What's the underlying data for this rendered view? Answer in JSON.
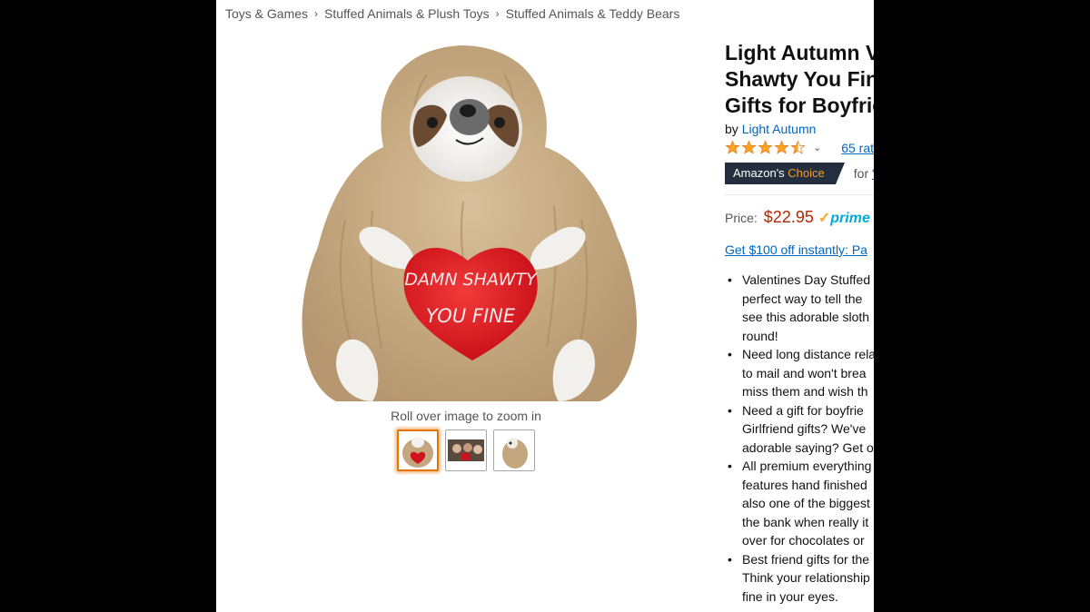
{
  "breadcrumb": {
    "items": [
      "Toys & Games",
      "Stuffed Animals & Plush Toys",
      "Stuffed Animals & Teddy Bears"
    ],
    "separator": "›"
  },
  "product": {
    "image_heart_text_line1": "DAMN SHAWTY",
    "image_heart_text_line2": "YOU FINE",
    "zoom_hint": "Roll over image to zoom in",
    "title_lines": [
      "Light Autumn V",
      "Shawty You Fine",
      "Gifts for Boyfrie"
    ],
    "by_prefix": "by",
    "brand": "Light Autumn",
    "star_rating": 4.5,
    "ratings_text": "65 rat",
    "choice_prefix": "Amazon's",
    "choice_word": "Choice",
    "choice_for": "for",
    "choice_query": "\"v",
    "price_label": "Price:",
    "price": "$22.95",
    "prime_check": "✓",
    "prime_label": "prime",
    "promo": "Get $100 off instantly: Pa",
    "bullets": [
      [
        "Valentines Day Stuffed",
        "perfect way to tell the",
        "see this adorable sloth",
        "round!"
      ],
      [
        "Need long distance rela",
        "to mail and won't brea",
        "miss them and wish th"
      ],
      [
        "Need a gift for boyfrie",
        "Girlfriend gifts? We've",
        "adorable saying? Get o"
      ],
      [
        "All premium everything",
        "features hand finished",
        "also one of the biggest",
        "the bank when really it",
        "over for chocolates or"
      ],
      [
        "Best friend gifts for the",
        "Think your relationship",
        "fine in your eyes."
      ]
    ]
  },
  "colors": {
    "link": "#0066c0",
    "price": "#b12704",
    "badge_bg": "#232f3e",
    "badge_accent": "#f69931",
    "star": "#ffa41c",
    "thumb_selected": "#e77600"
  }
}
